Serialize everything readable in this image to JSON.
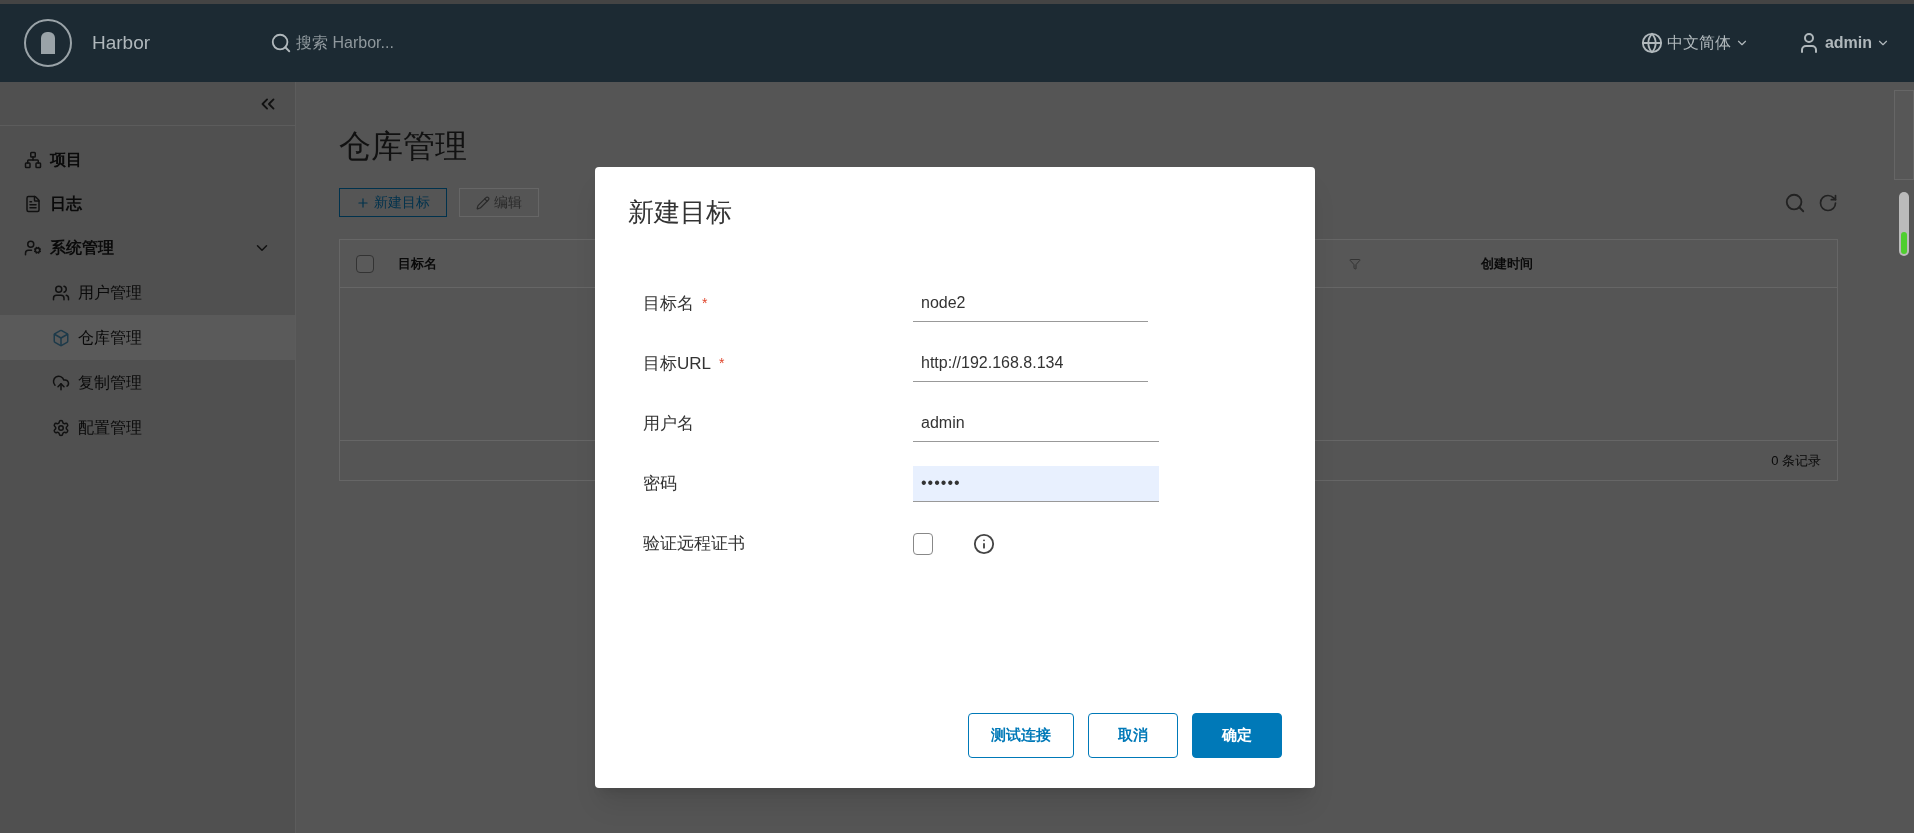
{
  "header": {
    "brand": "Harbor",
    "search_placeholder": "搜索 Harbor...",
    "language": "中文简体",
    "user": "admin"
  },
  "sidebar": {
    "items": [
      {
        "label": "项目",
        "kind": "top"
      },
      {
        "label": "日志",
        "kind": "top"
      },
      {
        "label": "系统管理",
        "kind": "group",
        "expanded": true,
        "children": [
          {
            "label": "用户管理",
            "selected": false
          },
          {
            "label": "仓库管理",
            "selected": true
          },
          {
            "label": "复制管理",
            "selected": false
          },
          {
            "label": "配置管理",
            "selected": false
          }
        ]
      }
    ]
  },
  "page": {
    "title": "仓库管理",
    "toolbar": [
      {
        "label": "新建目标",
        "disabled": false
      },
      {
        "label": "编辑",
        "disabled": true
      }
    ],
    "table": {
      "select_all_checked": false,
      "columns": [
        "目标名",
        "创建时间"
      ],
      "footer": "0 条记录"
    }
  },
  "dialog": {
    "title": "新建目标",
    "fields": [
      {
        "kind": "text",
        "label": "目标名",
        "required_mark": "*",
        "value": "node2"
      },
      {
        "kind": "text",
        "label": "目标URL",
        "required_mark": "*",
        "value": "http://192.168.8.134"
      },
      {
        "kind": "text",
        "label": "用户名",
        "value": "admin"
      },
      {
        "kind": "password",
        "label": "密码",
        "value": "••••••"
      },
      {
        "kind": "checkbox",
        "label": "验证远程证书",
        "checked": false
      }
    ],
    "buttons": [
      {
        "label": "测试连接",
        "primary": false
      },
      {
        "label": "取消",
        "primary": false
      },
      {
        "label": "确定",
        "primary": true
      }
    ]
  }
}
